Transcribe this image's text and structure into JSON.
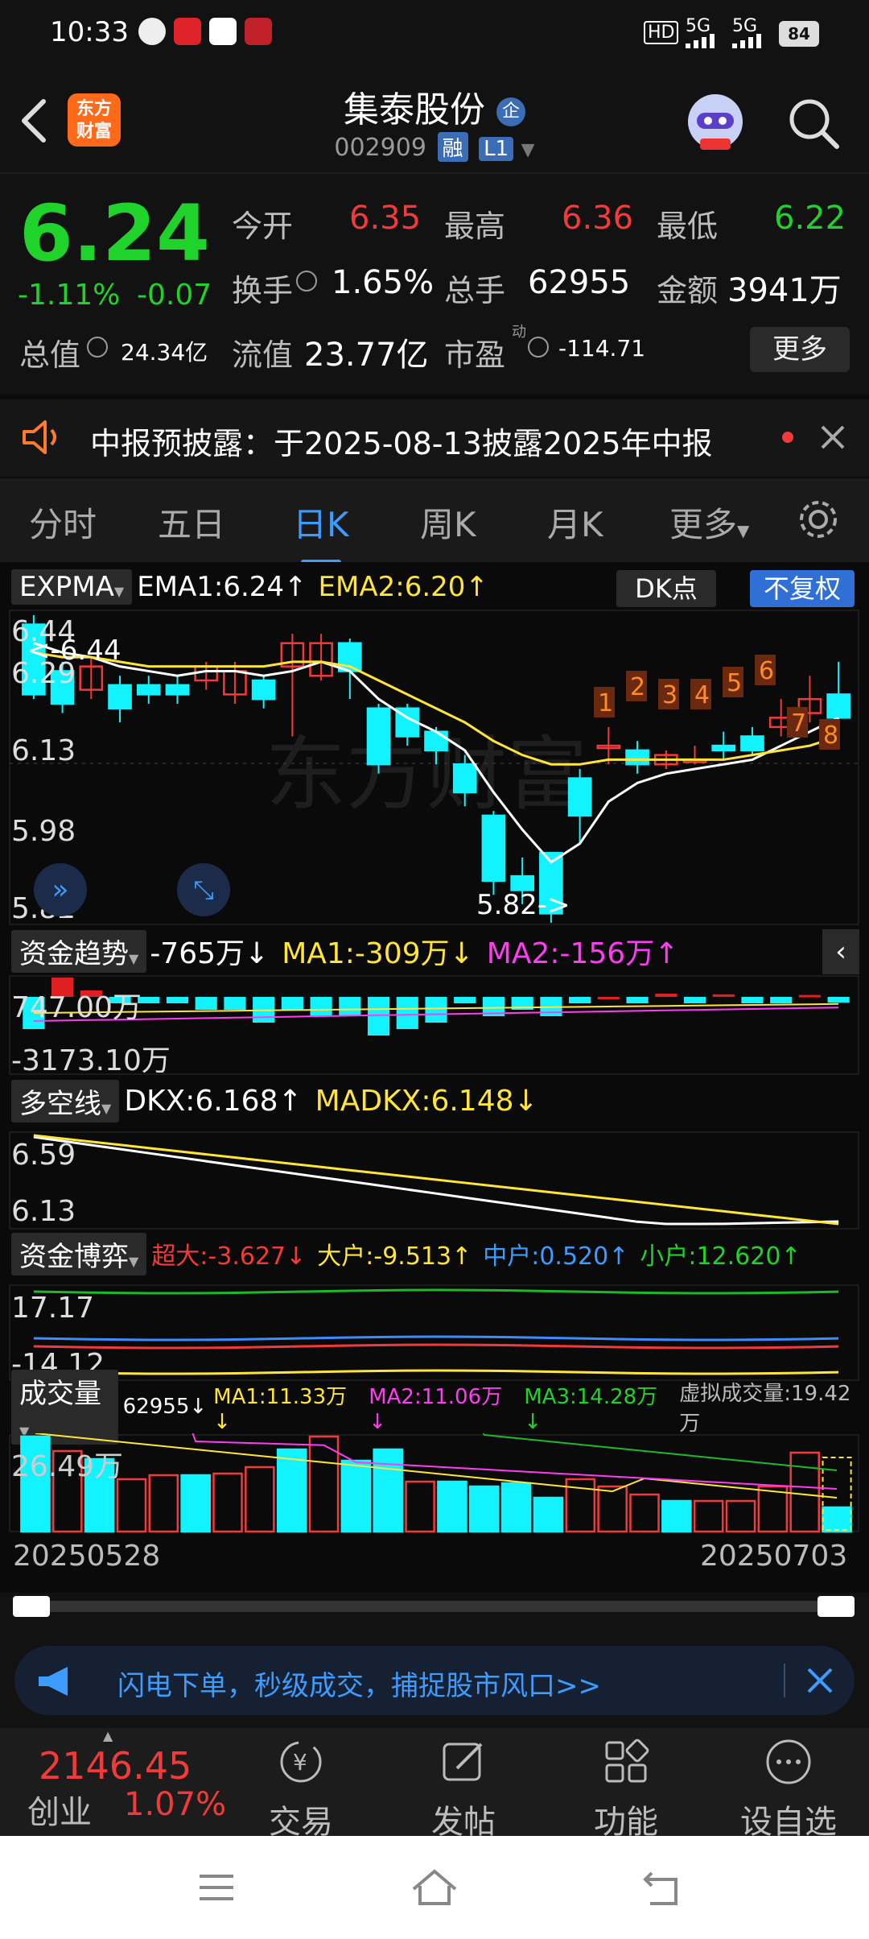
{
  "status_bar": {
    "time": "10:33",
    "signal": "5G",
    "signal2": "5G",
    "battery": "84"
  },
  "header": {
    "title": "集泰股份",
    "title_badge": "企",
    "code": "002909",
    "badge_rong": "融",
    "badge_level": "L1",
    "logo_line1": "东方",
    "logo_line2": "财富"
  },
  "quote": {
    "price": "6.24",
    "change_pct": "-1.11%",
    "change_abs": "-0.07",
    "open_label": "今开",
    "open": "6.35",
    "high_label": "最高",
    "high": "6.36",
    "low_label": "最低",
    "low": "6.22",
    "turnover_label": "换手",
    "turnover": "1.65%",
    "volume_label": "总手",
    "volume": "62955",
    "amount_label": "金额",
    "amount": "3941万",
    "mktcap_label": "总值",
    "mktcap": "24.34亿",
    "float_label": "流值",
    "float_cap": "23.77亿",
    "pe_label": "市盈",
    "pe_sup": "动",
    "pe": "-114.71",
    "more": "更多"
  },
  "notice": {
    "text": "中报预披露：于2025-08-13披露2025年中报"
  },
  "tabs": [
    {
      "label": "分时"
    },
    {
      "label": "五日"
    },
    {
      "label": "日K"
    },
    {
      "label": "周K"
    },
    {
      "label": "月K"
    },
    {
      "label": "更多"
    }
  ],
  "kline": {
    "indicator": "EXPMA",
    "ema1": "EMA1:6.24↑",
    "ema2": "EMA2:6.20↑",
    "dk_button": "DK点",
    "fq_button": "不复权",
    "axis_labels": [
      "6.44",
      "6.29",
      "6.13",
      "5.98",
      "5.82"
    ],
    "high_marker": "6.44",
    "low_marker": "5.82->",
    "dk_points": [
      "1",
      "2",
      "3",
      "4",
      "5",
      "6",
      "7",
      "8"
    ],
    "watermark": "东方财富"
  },
  "funds_trend": {
    "indicator": "资金趋势",
    "value": "-765万↓",
    "ma1": "MA1:-309万↓",
    "ma2": "MA2:-156万↑",
    "axis_top": "747.00万",
    "axis_bottom": "-3173.10万"
  },
  "dkx": {
    "indicator": "多空线",
    "dkx": "DKX:6.168↑",
    "madkx": "MADKX:6.148↓",
    "axis_top": "6.59",
    "axis_bottom": "6.13"
  },
  "funds_game": {
    "indicator": "资金博弈",
    "super": "超大:-3.627↓",
    "large": "大户:-9.513↑",
    "mid": "中户:0.520↑",
    "small": "小户:12.620↑",
    "axis_top": "17.17",
    "axis_bottom": "-14.12"
  },
  "volume_panel": {
    "indicator": "成交量",
    "vol": "62955↓",
    "ma1": "MA1:11.33万↓",
    "ma2": "MA2:11.06万↓",
    "ma3": "MA3:14.28万↓",
    "virtual": "虚拟成交量:19.42万",
    "axis_top": "26.49万",
    "date_start": "20250528",
    "date_end": "20250703"
  },
  "banner": {
    "text": "闪电下单，秒级成交，捕捉股市风口>>"
  },
  "bottom_nav": {
    "index_value": "2146.45",
    "index_name": "创业",
    "index_pct": "1.07%",
    "items": [
      {
        "label": "交易"
      },
      {
        "label": "发帖"
      },
      {
        "label": "功能"
      },
      {
        "label": "设自选"
      }
    ]
  }
}
